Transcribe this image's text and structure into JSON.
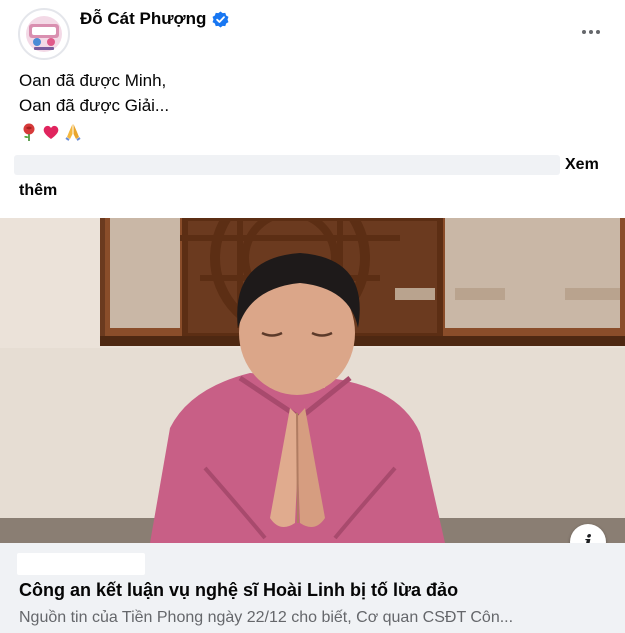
{
  "post": {
    "author": "Đỗ Cát Phượng",
    "verified": true,
    "lines": [
      "Oan đã được Minh,",
      "Oan đã được Giải..."
    ],
    "emoji": [
      "🌹",
      "❤️",
      "🙏"
    ],
    "see_more_part1": "Xem",
    "see_more_part2": "thêm"
  },
  "link_preview": {
    "title": "Công an kết luận vụ nghệ sĩ Hoài Linh bị tố lừa đảo",
    "description": "Nguồn tin của Tiền Phong ngày 22/12 cho biết, Cơ quan CSĐT Côn..."
  },
  "icons": {
    "more": "more-horizontal-icon",
    "verified": "verified-badge-icon",
    "info": "info-icon"
  },
  "colors": {
    "verified_blue": "#1877f2",
    "secondary_text": "#65676b",
    "footer_bg": "#f0f2f5"
  }
}
